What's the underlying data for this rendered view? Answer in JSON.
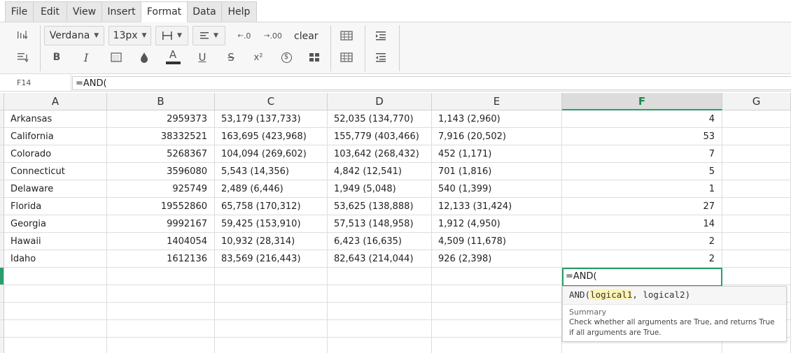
{
  "menu": [
    {
      "label": "File",
      "active": false
    },
    {
      "label": "Edit",
      "active": false
    },
    {
      "label": "View",
      "active": false
    },
    {
      "label": "Insert",
      "active": false
    },
    {
      "label": "Format",
      "active": true
    },
    {
      "label": "Data",
      "active": false
    },
    {
      "label": "Help",
      "active": false
    }
  ],
  "toolbar": {
    "font_family": "Verdana",
    "font_size": "13px",
    "clear_label": "clear",
    "bold": "B",
    "italic": "I",
    "text_color_glyph": "A",
    "underline_glyph": "U",
    "strike_glyph": "S",
    "superscript_glyph": "x²",
    "currency_glyph": "$",
    "decrease_decimal": ".0",
    "increase_decimal": ".00"
  },
  "colors": {
    "accent_green": "#2a9d6a",
    "selected_header_text": "#21864a",
    "highlight_yellow": "#fdf3b2"
  },
  "formula_bar": {
    "cell_ref": "F14",
    "formula": "=AND("
  },
  "columns": [
    "A",
    "B",
    "C",
    "D",
    "E",
    "F",
    "G"
  ],
  "selected_column": "F",
  "rows": [
    [
      "Arkansas",
      "2959373",
      "53,179 (137,733)",
      "52,035 (134,770)",
      "1,143 (2,960)",
      "4"
    ],
    [
      "California",
      "38332521",
      "163,695 (423,968)",
      "155,779 (403,466)",
      "7,916 (20,502)",
      "53"
    ],
    [
      "Colorado",
      "5268367",
      "104,094 (269,602)",
      "103,642 (268,432)",
      "452 (1,171)",
      "7"
    ],
    [
      "Connecticut",
      "3596080",
      "5,543 (14,356)",
      "4,842 (12,541)",
      "701 (1,816)",
      "5"
    ],
    [
      "Delaware",
      "925749",
      "2,489 (6,446)",
      "1,949 (5,048)",
      "540 (1,399)",
      "1"
    ],
    [
      "Florida",
      "19552860",
      "65,758 (170,312)",
      "53,625 (138,888)",
      "12,133 (31,424)",
      "27"
    ],
    [
      "Georgia",
      "9992167",
      "59,425 (153,910)",
      "57,513 (148,958)",
      "1,912 (4,950)",
      "14"
    ],
    [
      "Hawaii",
      "1404054",
      "10,932 (28,314)",
      "6,423 (16,635)",
      "4,509 (11,678)",
      "2"
    ],
    [
      "Idaho",
      "1612136",
      "83,569 (216,443)",
      "82,643 (214,044)",
      "926 (2,398)",
      "2"
    ]
  ],
  "editor": {
    "value": "=AND("
  },
  "autocomplete": {
    "fn": "AND(",
    "arg1": "logical1",
    "rest": ", logical2)",
    "summary_label": "Summary",
    "summary_text": "Check whether all arguments are True, and returns True if all arguments are True."
  }
}
